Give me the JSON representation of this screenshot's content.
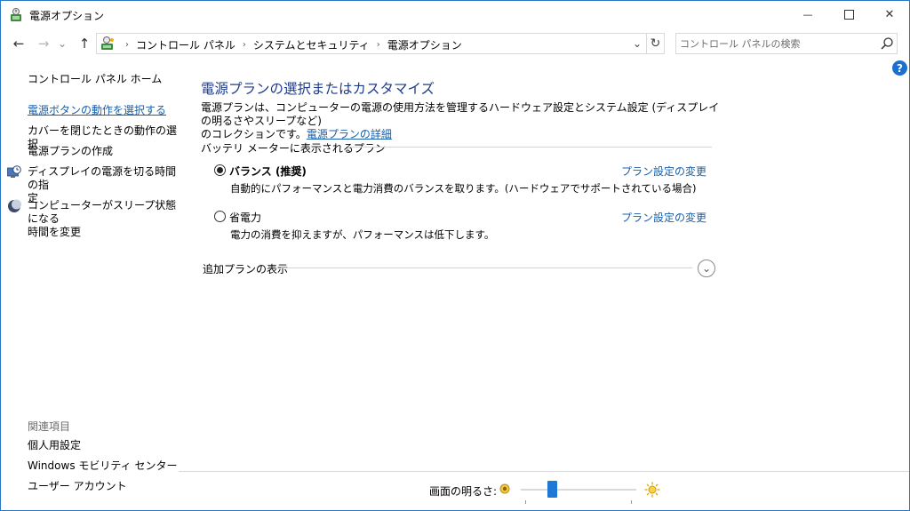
{
  "window": {
    "title": "電源オプション",
    "minimize_glyph": "—",
    "close_glyph": "✕"
  },
  "navigation": {
    "back_glyph": "←",
    "forward_glyph": "→",
    "recent_glyph": "⌄",
    "up_glyph": "↑",
    "breadcrumb": [
      "コントロール パネル",
      "システムとセキュリティ",
      "電源オプション"
    ],
    "breadcrumb_separator": "›",
    "dropdown_glyph": "⌄",
    "refresh_glyph": "↻",
    "search_placeholder": "コントロール パネルの検索"
  },
  "help": {
    "glyph": "?"
  },
  "sidebar": {
    "home": "コントロール パネル ホーム",
    "items": [
      {
        "label": "電源ボタンの動作を選択する",
        "selected": true
      },
      {
        "label": "カバーを閉じたときの動作の選択"
      },
      {
        "label": "電源プランの作成"
      },
      {
        "label_line1": "ディスプレイの電源を切る時間の指",
        "label_line2": "定",
        "icon": "clock-monitor-icon"
      },
      {
        "label_line1": "コンピューターがスリープ状態になる",
        "label_line2": "時間を変更",
        "icon": "moon-icon"
      }
    ],
    "related_heading": "関連項目",
    "related": [
      "個人用設定",
      "Windows モビリティ センター",
      "ユーザー アカウント"
    ]
  },
  "main": {
    "heading": "電源プランの選択またはカスタマイズ",
    "description_line1": "電源プランは、コンピューターの電源の使用方法を管理するハードウェア設定とシステム設定 (ディスプレイの明るさやスリープなど)",
    "description_line2": "のコレクションです。",
    "details_link": "電源プランの詳細",
    "group_label": "バッテリ メーターに表示されるプラン",
    "plans": [
      {
        "name": "バランス (推奨)",
        "description": "自動的にパフォーマンスと電力消費のバランスを取ります。(ハードウェアでサポートされている場合)",
        "link": "プラン設定の変更",
        "selected": true
      },
      {
        "name": "省電力",
        "description": "電力の消費を抑えますが、パフォーマンスは低下します。",
        "link": "プラン設定の変更",
        "selected": false
      }
    ],
    "more_plans_label": "追加プランの表示",
    "expand_glyph": "⌄"
  },
  "brightness": {
    "label": "画面の明るさ:",
    "value_fraction": 0.25
  },
  "colors": {
    "link": "#1a5fa8",
    "heading": "#1e3c8c",
    "accent": "#1e78d6"
  }
}
